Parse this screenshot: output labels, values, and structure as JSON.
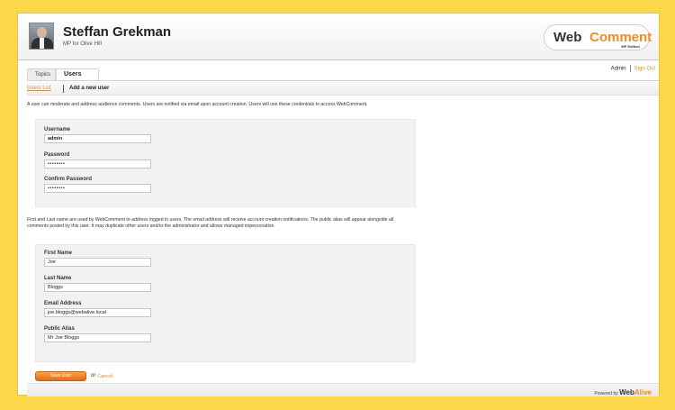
{
  "header": {
    "title": "Steffan Grekman",
    "subtitle": "MP for Olive Hill",
    "logo_part1": "Web",
    "logo_part2": "Comment",
    "logo_edition": "MP Edition"
  },
  "tabs": [
    {
      "label": "Topics",
      "active": false
    },
    {
      "label": "Users",
      "active": true
    }
  ],
  "account": {
    "admin_label": "Admin",
    "signout_label": "Sign Out"
  },
  "subnav": {
    "users_list": "Users List",
    "add_user": "Add a new user"
  },
  "intro_credentials": "A user can moderate and address audience comments.  Users are notified via email upon account creation. Users will use these credentials to access WebComment.",
  "credentials": {
    "username_label": "Username",
    "username_value": "admin",
    "password_label": "Password",
    "password_value": "••••••••",
    "confirm_label": "Confirm Password",
    "confirm_value": "••••••••"
  },
  "intro_profile": "First and Last name are used by WebComment to address logged in users. The email address will receive account creation notifications. The public alias will appear alongside all comments posted by this user.  It may duplicate other users and/or the administrator and allows managed impersonation",
  "profile": {
    "first_label": "First Name",
    "first_value": "Joe",
    "last_label": "Last Name",
    "last_value": "Bloggs",
    "email_label": "Email Address",
    "email_value": "joe.bloggs@webalive.local",
    "alias_label": "Public Alias",
    "alias_value": "Mr Joe Bloggs"
  },
  "actions": {
    "save_label": "Save User",
    "or_label": "or",
    "cancel_label": "Cancel"
  },
  "footer": {
    "powered_by": "Powered by",
    "brand_part1": "Web",
    "brand_part2": "Alive"
  },
  "colors": {
    "accent": "#f08a24",
    "page_background": "#fcd74a"
  }
}
